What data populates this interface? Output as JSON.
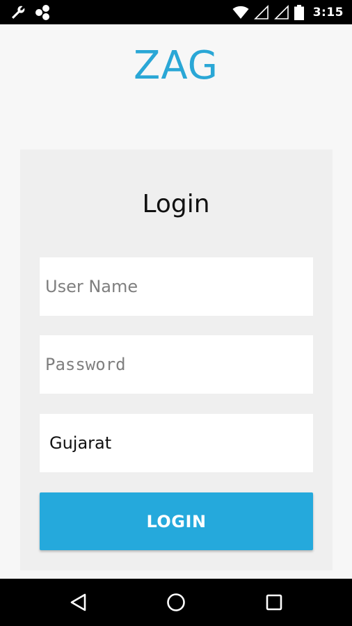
{
  "status_bar": {
    "time": "3:15",
    "left_icons": [
      "wrench-icon",
      "share-icon"
    ],
    "right_icons": [
      "wifi-icon",
      "signal-icon",
      "signal-icon",
      "battery-icon"
    ]
  },
  "app": {
    "title": "ZAG",
    "brand_color": "#2aa7d6"
  },
  "login_form": {
    "heading": "Login",
    "username": {
      "value": "",
      "placeholder": "User Name"
    },
    "password": {
      "value": "",
      "placeholder": "Password"
    },
    "state": {
      "selected": "Gujarat"
    },
    "submit_label": "LOGIN",
    "button_color": "#25a9dc"
  },
  "nav_bar": {
    "buttons": [
      "back-icon",
      "home-icon",
      "recents-icon"
    ]
  }
}
